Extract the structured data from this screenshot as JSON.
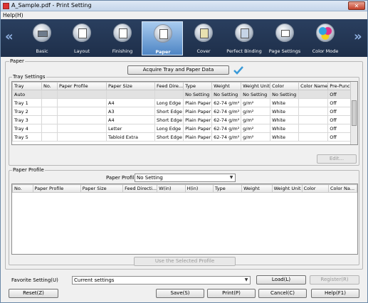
{
  "window": {
    "title": "A_Sample.pdf - Print Setting",
    "close": "✕"
  },
  "menu": {
    "help": "Help(H)"
  },
  "nav": {
    "left_arrow": "«",
    "right_arrow": "»",
    "tabs": [
      {
        "label": "Basic",
        "icon": "printer-icon"
      },
      {
        "label": "Layout",
        "icon": "layout-icon"
      },
      {
        "label": "Finishing",
        "icon": "finishing-icon"
      },
      {
        "label": "Paper",
        "icon": "paper-icon",
        "active": true
      },
      {
        "label": "Cover",
        "icon": "cover-icon"
      },
      {
        "label": "Perfect Binding",
        "icon": "perfect-binding-icon"
      },
      {
        "label": "Page Settings",
        "icon": "page-settings-icon"
      },
      {
        "label": "Color Mode",
        "icon": "color-mode-icon"
      }
    ]
  },
  "paper_group": {
    "legend": "Paper",
    "acquire_button": "Acquire Tray and Paper Data",
    "tray_settings": {
      "legend": "Tray Settings",
      "columns": [
        "Tray",
        "No.",
        "Paper Profile",
        "Paper Size",
        "Feed Dire...",
        "Type",
        "Weight",
        "Weight Unit",
        "Color",
        "Color Name",
        "Pre-Punch"
      ],
      "rows": [
        [
          "Auto",
          "",
          "",
          "",
          "",
          "No Setting",
          "No Setting",
          "No Setting",
          "No Setting",
          "",
          "Off"
        ],
        [
          "Tray 1",
          "",
          "",
          "A4",
          "Long Edge",
          "Plain Paper",
          "62-74 g/m²",
          "g/m²",
          "White",
          "",
          "Off"
        ],
        [
          "Tray 2",
          "",
          "",
          "A3",
          "Short Edge",
          "Plain Paper",
          "62-74 g/m²",
          "g/m²",
          "White",
          "",
          "Off"
        ],
        [
          "Tray 3",
          "",
          "",
          "A4",
          "Short Edge",
          "Plain Paper",
          "62-74 g/m²",
          "g/m²",
          "White",
          "",
          "Off"
        ],
        [
          "Tray 4",
          "",
          "",
          "Letter",
          "Long Edge",
          "Plain Paper",
          "62-74 g/m²",
          "g/m²",
          "White",
          "",
          "Off"
        ],
        [
          "Tray 5",
          "",
          "",
          "Tabloid Extra",
          "Short Edge",
          "Plain Paper",
          "62-74 g/m²",
          "g/m²",
          "White",
          "",
          "Off"
        ]
      ],
      "edit_button": "Edit..."
    },
    "paper_profile": {
      "legend": "Paper Profile",
      "select_label": "Paper Profile",
      "select_value": "No Setting",
      "columns": [
        "No.",
        "Paper Profile",
        "Paper Size",
        "Feed Directi...",
        "W(in)",
        "H(in)",
        "Type",
        "Weight",
        "Weight Unit",
        "Color",
        "Color Na..."
      ],
      "use_button": "Use the Selected Profile"
    }
  },
  "footer": {
    "favorite_label": "Favorite Setting(U)",
    "favorite_value": "Current settings",
    "load": "Load(L)",
    "register": "Register(R)",
    "reset": "Reset(Z)",
    "save": "Save(S)",
    "print": "Print(P)",
    "cancel": "Cancel(C)",
    "help": "Help(F1)"
  }
}
